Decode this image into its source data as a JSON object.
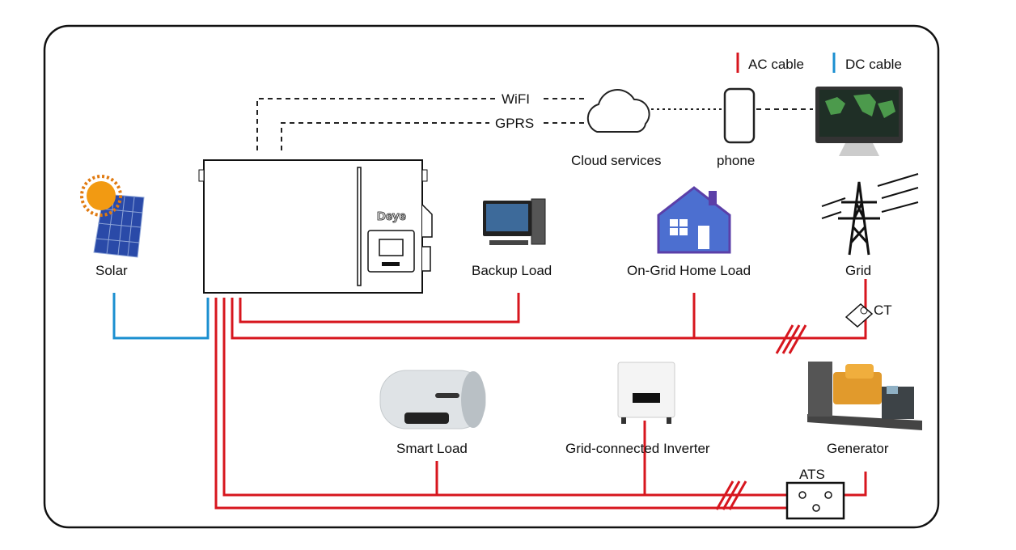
{
  "legend": {
    "ac_label": "AC cable",
    "dc_label": "DC cable",
    "ac_color": "#d7161e",
    "dc_color": "#1b8fd0"
  },
  "comm": {
    "wifi": "WiFI",
    "gprs": "GPRS"
  },
  "nodes": {
    "solar": "Solar",
    "inverter_brand": "Deye",
    "cloud": "Cloud services",
    "phone": "phone",
    "backup_load": "Backup Load",
    "on_grid_home_load": "On-Grid Home Load",
    "grid": "Grid",
    "ct": "CT",
    "smart_load": "Smart Load",
    "grid_connected_inverter": "Grid-connected Inverter",
    "generator": "Generator",
    "ats": "ATS"
  }
}
